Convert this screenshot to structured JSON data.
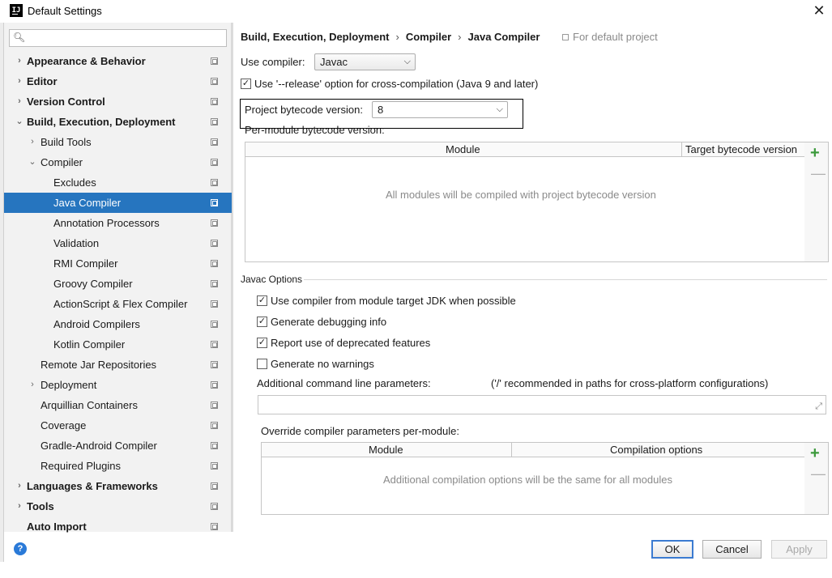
{
  "window": {
    "title": "Default Settings",
    "app_icon_text": "IJ"
  },
  "sidebar": {
    "search_placeholder": "",
    "items": [
      {
        "label": "Appearance & Behavior",
        "level": 0,
        "bold": true,
        "arrow": "›",
        "selected": false
      },
      {
        "label": "Editor",
        "level": 0,
        "bold": true,
        "arrow": "›",
        "selected": false
      },
      {
        "label": "Version Control",
        "level": 0,
        "bold": true,
        "arrow": "›",
        "selected": false
      },
      {
        "label": "Build, Execution, Deployment",
        "level": 0,
        "bold": true,
        "arrow": "⌄",
        "selected": false
      },
      {
        "label": "Build Tools",
        "level": 1,
        "bold": false,
        "arrow": "›",
        "selected": false
      },
      {
        "label": "Compiler",
        "level": 1,
        "bold": false,
        "arrow": "⌄",
        "selected": false
      },
      {
        "label": "Excludes",
        "level": 2,
        "bold": false,
        "arrow": "",
        "selected": false
      },
      {
        "label": "Java Compiler",
        "level": 2,
        "bold": false,
        "arrow": "",
        "selected": true
      },
      {
        "label": "Annotation Processors",
        "level": 2,
        "bold": false,
        "arrow": "",
        "selected": false
      },
      {
        "label": "Validation",
        "level": 2,
        "bold": false,
        "arrow": "",
        "selected": false
      },
      {
        "label": "RMI Compiler",
        "level": 2,
        "bold": false,
        "arrow": "",
        "selected": false
      },
      {
        "label": "Groovy Compiler",
        "level": 2,
        "bold": false,
        "arrow": "",
        "selected": false
      },
      {
        "label": "ActionScript & Flex Compiler",
        "level": 2,
        "bold": false,
        "arrow": "",
        "selected": false
      },
      {
        "label": "Android Compilers",
        "level": 2,
        "bold": false,
        "arrow": "",
        "selected": false
      },
      {
        "label": "Kotlin Compiler",
        "level": 2,
        "bold": false,
        "arrow": "",
        "selected": false
      },
      {
        "label": "Remote Jar Repositories",
        "level": 1,
        "bold": false,
        "arrow": "",
        "selected": false
      },
      {
        "label": "Deployment",
        "level": 1,
        "bold": false,
        "arrow": "›",
        "selected": false
      },
      {
        "label": "Arquillian Containers",
        "level": 1,
        "bold": false,
        "arrow": "",
        "selected": false
      },
      {
        "label": "Coverage",
        "level": 1,
        "bold": false,
        "arrow": "",
        "selected": false
      },
      {
        "label": "Gradle-Android Compiler",
        "level": 1,
        "bold": false,
        "arrow": "",
        "selected": false
      },
      {
        "label": "Required Plugins",
        "level": 1,
        "bold": false,
        "arrow": "",
        "selected": false
      },
      {
        "label": "Languages & Frameworks",
        "level": 0,
        "bold": true,
        "arrow": "›",
        "selected": false
      },
      {
        "label": "Tools",
        "level": 0,
        "bold": true,
        "arrow": "›",
        "selected": false
      },
      {
        "label": "Auto Import",
        "level": 0,
        "bold": true,
        "arrow": "",
        "selected": false
      }
    ]
  },
  "breadcrumb": {
    "parts": [
      "Build, Execution, Deployment",
      "Compiler",
      "Java Compiler"
    ],
    "separator": "›",
    "scope_note": "For default project"
  },
  "compiler": {
    "use_compiler_label": "Use compiler:",
    "use_compiler_value": "Javac",
    "release_option_label": "Use '--release' option for cross-compilation (Java 9 and later)",
    "release_option_checked": true,
    "bytecode_label": "Project bytecode version:",
    "bytecode_value": "8",
    "per_module_label": "Per-module bytecode version:"
  },
  "module_table": {
    "columns": [
      "Module",
      "Target bytecode version"
    ],
    "empty_text": "All modules will be compiled with project bytecode version"
  },
  "javac_options": {
    "section_title": "Javac Options",
    "checkboxes": [
      {
        "label": "Use compiler from module target JDK when possible",
        "checked": true
      },
      {
        "label": "Generate debugging info",
        "checked": true
      },
      {
        "label": "Report use of deprecated features",
        "checked": true
      },
      {
        "label": "Generate no warnings",
        "checked": false
      }
    ],
    "additional_params_label": "Additional command line parameters:",
    "additional_params_hint": "('/' recommended in paths for cross-platform configurations)",
    "additional_params_value": "",
    "override_label": "Override compiler parameters per-module:"
  },
  "override_table": {
    "columns": [
      "Module",
      "Compilation options"
    ],
    "empty_text": "Additional compilation options will be the same for all modules"
  },
  "buttons": {
    "ok": "OK",
    "cancel": "Cancel",
    "apply": "Apply",
    "help": "?"
  },
  "icons": {
    "close": "close-icon",
    "search": "search-icon",
    "add": "plus-icon",
    "remove": "minus-icon",
    "help": "help-icon"
  },
  "colors": {
    "selection": "#2675bf",
    "add_green": "#3c9a3c",
    "primary_border": "#3b7bd1"
  }
}
